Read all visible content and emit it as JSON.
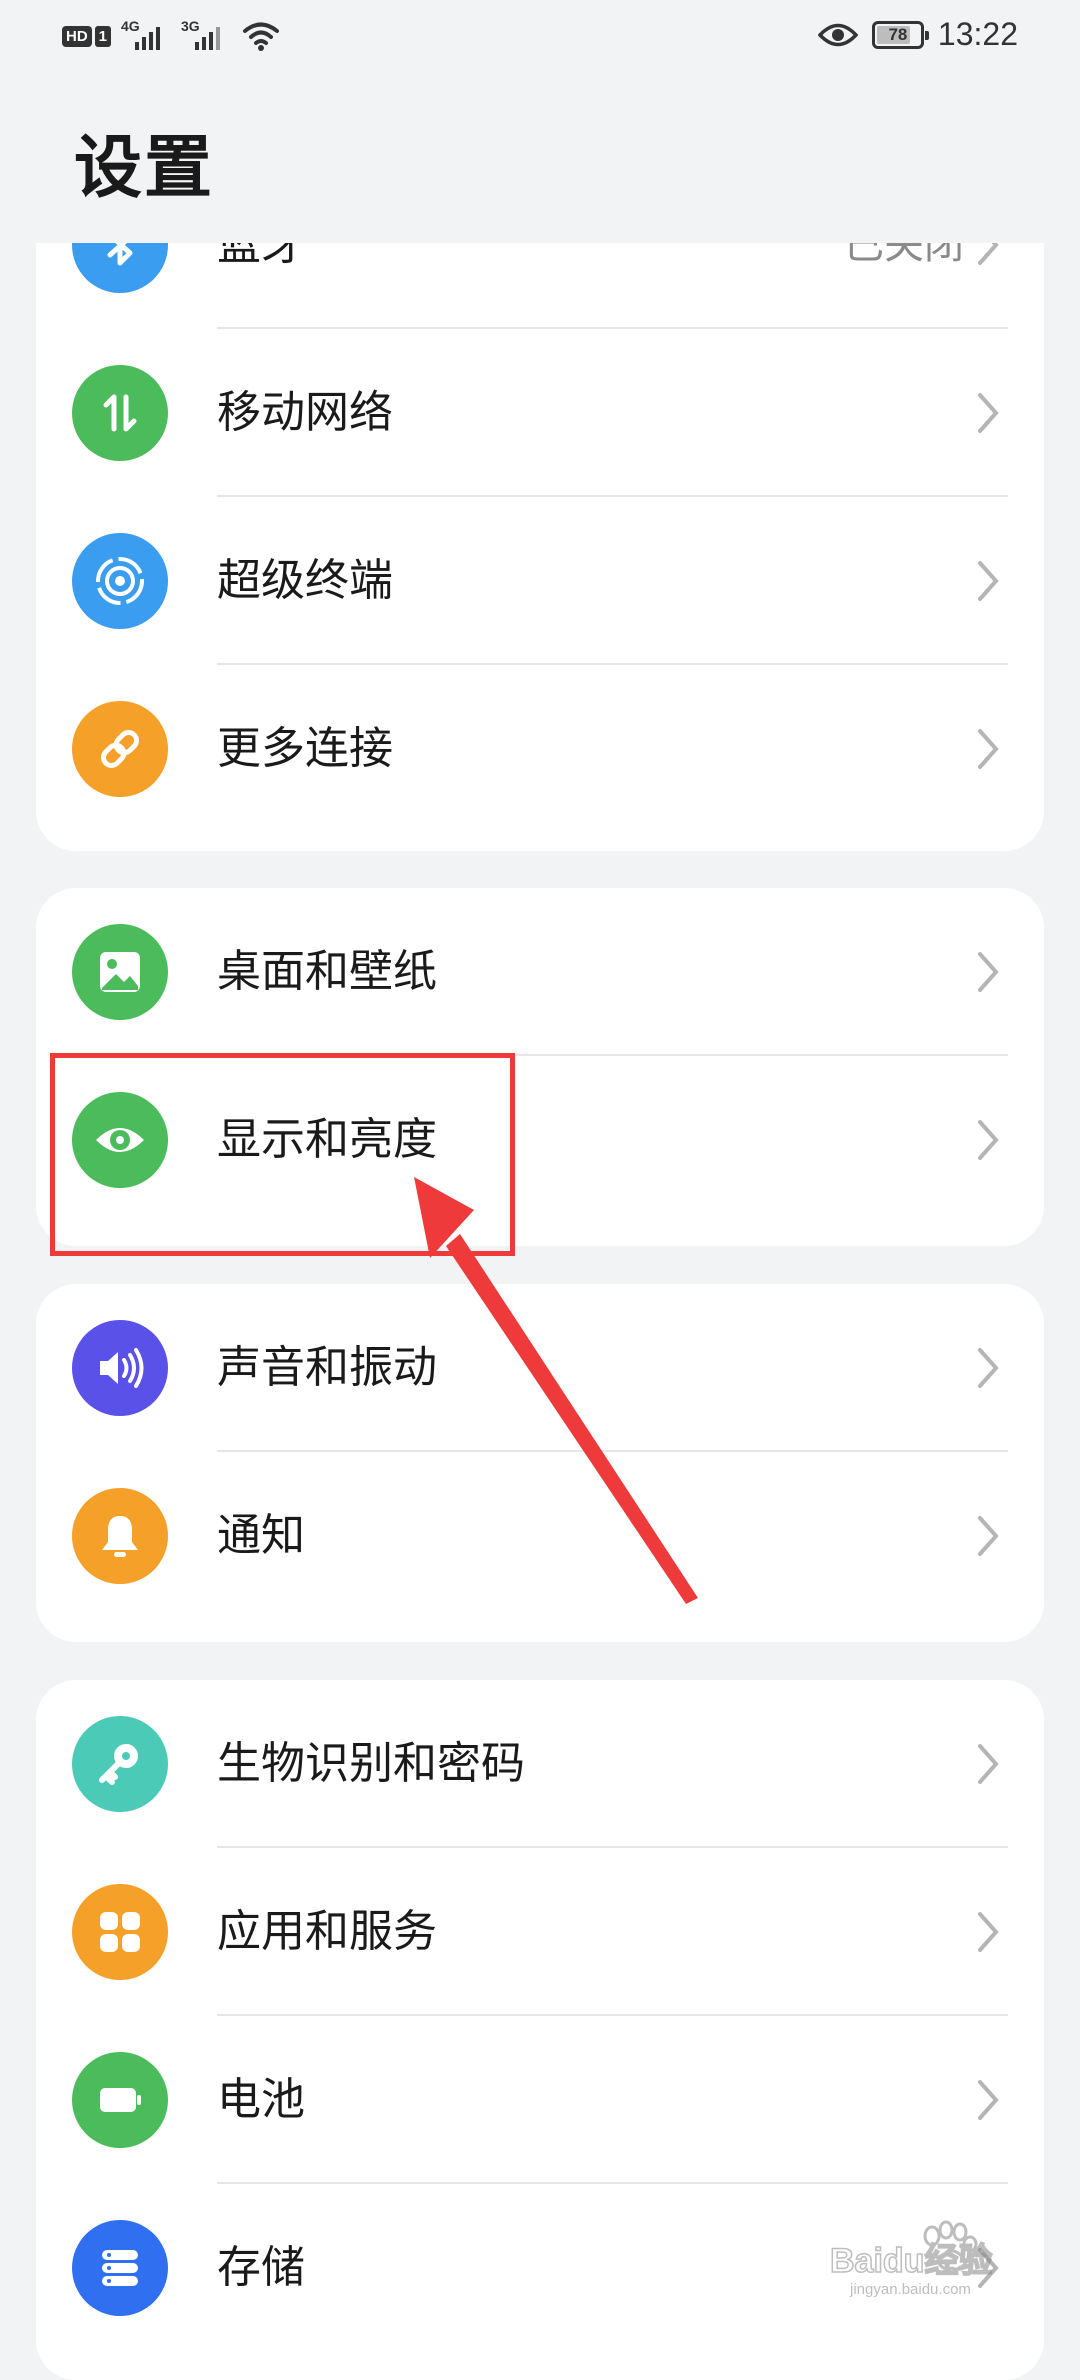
{
  "status_bar": {
    "hd": "HD",
    "sim": "1",
    "net1": "4G",
    "net2": "3G",
    "battery": "78",
    "battery_level_percent": 78,
    "time": "13:22",
    "icons": [
      "wifi-icon",
      "eye-comfort-icon"
    ]
  },
  "page": {
    "title": "设置"
  },
  "groups": [
    {
      "items": [
        {
          "label": "蓝牙",
          "value": "已关闭",
          "icon": "bluetooth-icon",
          "color": "#3b9df0"
        },
        {
          "label": "移动网络",
          "icon": "mobile-data-icon",
          "color": "#4cbb5c"
        },
        {
          "label": "超级终端",
          "icon": "super-device-icon",
          "color": "#3b9df0"
        },
        {
          "label": "更多连接",
          "icon": "link-icon",
          "color": "#f5a028"
        }
      ]
    },
    {
      "items": [
        {
          "label": "桌面和壁纸",
          "icon": "wallpaper-icon",
          "color": "#4cbb5c"
        },
        {
          "label": "显示和亮度",
          "icon": "eye-icon",
          "color": "#4cbb5c"
        }
      ]
    },
    {
      "items": [
        {
          "label": "声音和振动",
          "icon": "speaker-icon",
          "color": "#5a52e8"
        },
        {
          "label": "通知",
          "icon": "bell-icon",
          "color": "#f5a028"
        }
      ]
    },
    {
      "items": [
        {
          "label": "生物识别和密码",
          "icon": "key-icon",
          "color": "#4ccab8"
        },
        {
          "label": "应用和服务",
          "icon": "apps-icon",
          "color": "#f5a028"
        },
        {
          "label": "电池",
          "icon": "battery-icon",
          "color": "#4cbb5c"
        },
        {
          "label": "存储",
          "icon": "storage-icon",
          "color": "#2f6ff0"
        }
      ]
    }
  ],
  "watermark": {
    "text": "Baidu经验",
    "sub": "jingyan.baidu.com"
  }
}
